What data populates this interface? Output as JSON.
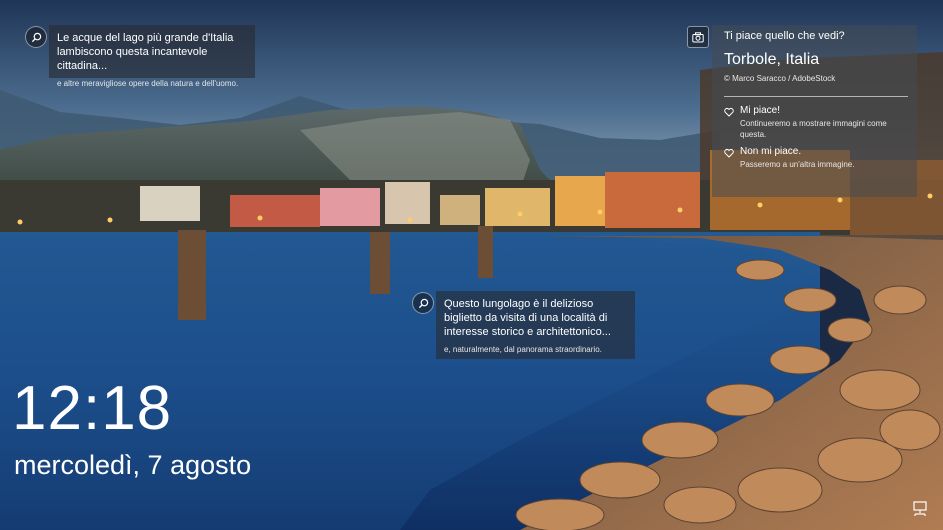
{
  "hotspots": [
    {
      "title": "Le acque del lago più grande d'Italia lambiscono questa incantevole cittadina...",
      "subtitle": "e altre meravigliose opere della natura e dell'uomo."
    },
    {
      "title": "Questo lungolago è il delizioso biglietto da visita di una località di interesse storico e architettonico...",
      "subtitle": "e, naturalmente, dal panorama straordinario."
    }
  ],
  "spotlight": {
    "question": "Ti piace quello che vedi?",
    "location": "Torbole, Italia",
    "credit": "© Marco Saracco / AdobeStock",
    "like_label": "Mi piace!",
    "like_desc": "Continueremo a mostrare immagini come questa.",
    "dislike_label": "Non mi piace.",
    "dislike_desc": "Passeremo a un'altra immagine."
  },
  "lockscreen": {
    "time": "12:18",
    "date": "mercoledì, 7 agosto"
  },
  "icons": {
    "hotspot": "search-icon",
    "camera": "camera-icon",
    "like": "heart-icon",
    "dislike": "heart-icon",
    "network": "network-icon"
  }
}
